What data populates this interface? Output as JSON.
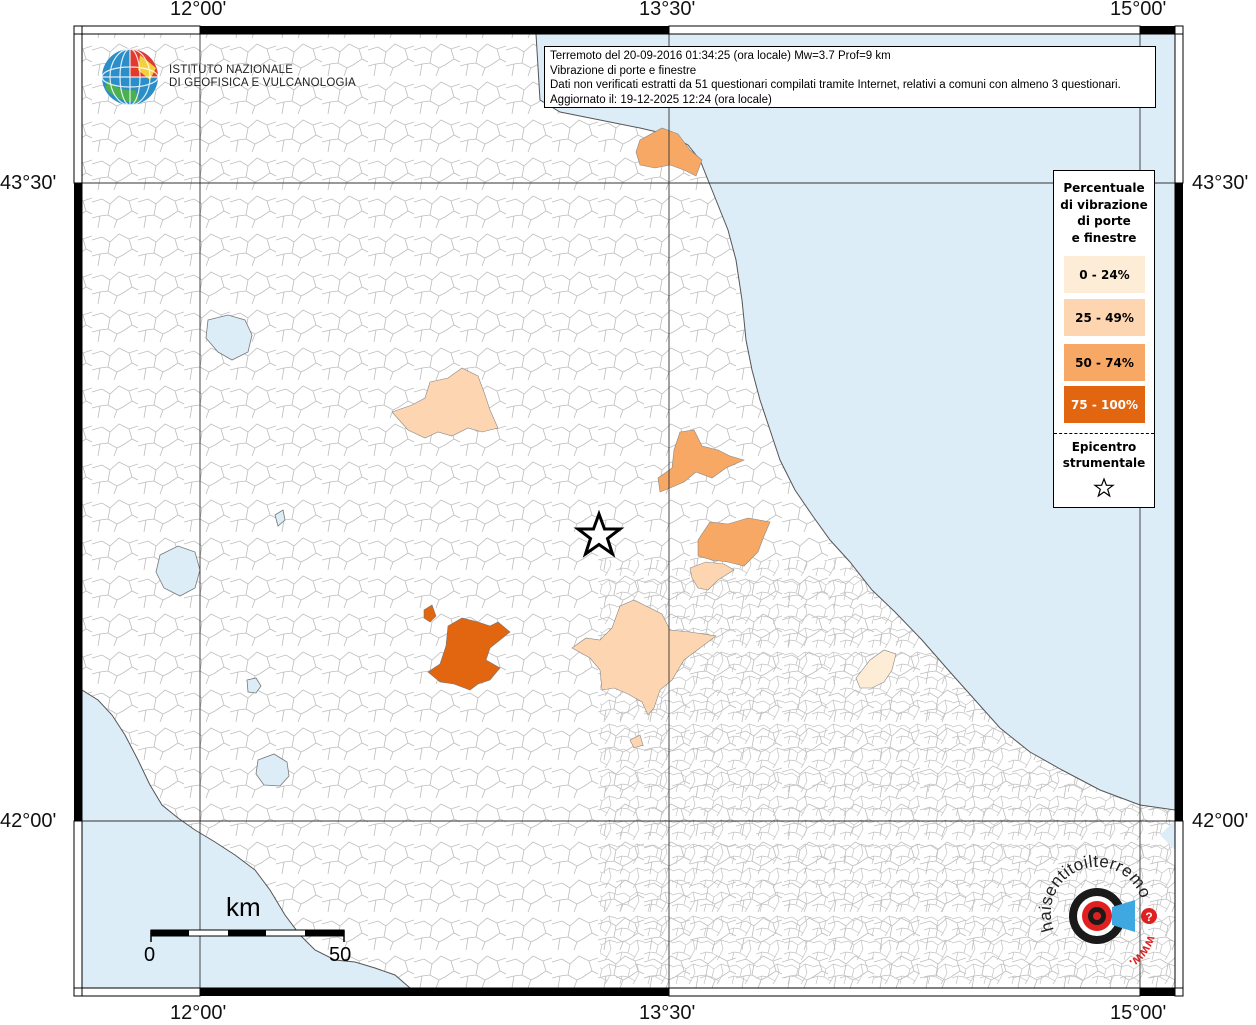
{
  "header": {
    "line1": "Terremoto del 20-09-2016 01:34:25 (ora locale) Mw=3.7 Prof=9 km",
    "line2": "Vibrazione di porte e finestre",
    "line3": "Dati non verificati estratti da 51 questionari compilati tramite Internet, relativi a comuni con almeno 3 questionari.",
    "line4": "Aggiornato il: 19-12-2025 12:24 (ora locale)"
  },
  "logo": {
    "line1": "ISTITUTO NAZIONALE",
    "line2": "DI GEOFISICA E VULCANOLOGIA"
  },
  "axes": {
    "top": [
      "12°00'",
      "13°30'",
      "15°00'"
    ],
    "bottom": [
      "12°00'",
      "13°30'",
      "15°00'"
    ],
    "left": [
      "43°30'",
      "42°00'"
    ],
    "right": [
      "43°30'",
      "42°00'"
    ]
  },
  "legend": {
    "title": [
      "Percentuale",
      "di vibrazione",
      "di porte",
      "e finestre"
    ],
    "classes": [
      {
        "label": "0 - 24%",
        "color": "#fdecd6"
      },
      {
        "label": "25 - 49%",
        "color": "#fdd5b1"
      },
      {
        "label": "50 - 74%",
        "color": "#f8a865"
      },
      {
        "label": "75 - 100%",
        "color": "#e26510"
      }
    ],
    "epicenter_label": [
      "Epicentro",
      "strumentale"
    ]
  },
  "scale": {
    "unit": "km",
    "start": "0",
    "end": "50"
  },
  "watermark": {
    "text": "haisentitoilterremoto.it",
    "www": "www."
  },
  "colors": {
    "sea": "#dcedf8",
    "land": "#ffffff",
    "borders": "#b8b8b8",
    "frame": "#000000"
  }
}
